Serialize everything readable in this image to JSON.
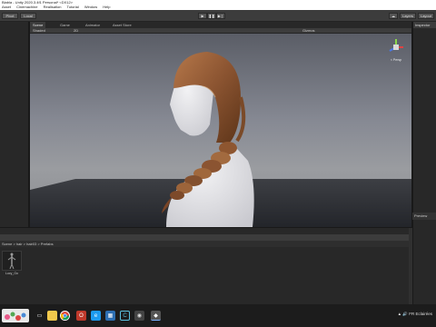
{
  "window": {
    "title": "Blabla - Unity 2020.3.4f1 Personal* <DX12>"
  },
  "menu": {
    "items": [
      "Asset",
      "Cinemachine",
      "Realisation",
      "Tutorial",
      "Window",
      "Help"
    ]
  },
  "toolbar": {
    "pivot": "Pivot",
    "local": "Local",
    "layers": "Layers",
    "layout": "Layout"
  },
  "tabs": [
    "Scene",
    "Game",
    "Animator",
    "Asset Store"
  ],
  "scene_toolbar": {
    "shading": "Shaded",
    "mode_2d": "2D",
    "gizmos": "Gizmos"
  },
  "gizmo": {
    "label": "< Persp"
  },
  "inspector": {
    "title": "Inspector"
  },
  "preview": {
    "title": "Preview"
  },
  "project": {
    "breadcrumb": "Scene > hair > hair03 > Prefabs",
    "asset_name": "Lucy_Go"
  },
  "taskbar": {
    "language": "FR",
    "user": "Eclairées"
  }
}
